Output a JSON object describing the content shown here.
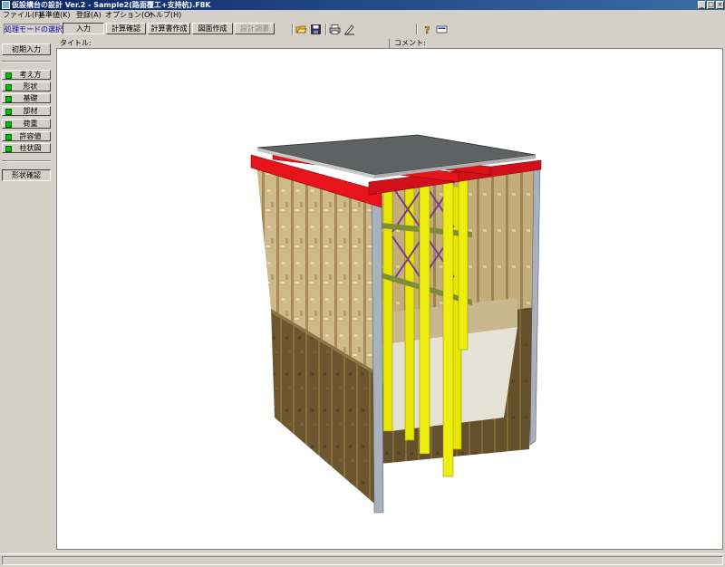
{
  "window": {
    "title": "仮設構台の設計 Ver.2 - Sample2(路面覆工+支持杭).F8K",
    "controls": {
      "minimize": "_",
      "maximize": "□",
      "close": "×"
    }
  },
  "menu": [
    "ファイル(F)",
    "基準値(K)",
    "登録(A)",
    "オプション(O)",
    "ヘルプ(H)"
  ],
  "toolbar": {
    "mode_label": "処理モードの選択",
    "buttons": [
      {
        "label": "入力",
        "selected": true,
        "enabled": true
      },
      {
        "label": "計算確認",
        "selected": false,
        "enabled": true
      },
      {
        "label": "計算書作成",
        "selected": false,
        "enabled": true
      },
      {
        "label": "図面作成",
        "selected": false,
        "enabled": true
      },
      {
        "label": "設計調書",
        "selected": false,
        "enabled": false
      }
    ],
    "icons": [
      "open-folder-icon",
      "save-icon",
      "print-icon",
      "edit-icon",
      "help-icon",
      "info-icon"
    ]
  },
  "sidebar": {
    "initial_input": "初期入力",
    "items": [
      {
        "label": "考え方",
        "status": "green"
      },
      {
        "label": "形状",
        "status": "green"
      },
      {
        "label": "基礎",
        "status": "green"
      },
      {
        "label": "部材",
        "status": "green"
      },
      {
        "label": "荷重",
        "status": "green"
      },
      {
        "label": "許容値",
        "status": "green"
      },
      {
        "label": "柱状図",
        "status": "green"
      }
    ],
    "shape_check": "形状確認"
  },
  "info": {
    "title_label": "タイトル:",
    "comment_label": "コメント:"
  },
  "colors": {
    "titlebar": "#0a246a",
    "lamp": "#00c000",
    "mode_text": "#0000c0",
    "deck": "#606060",
    "girder": "#e8141c",
    "pile": "#e6e600",
    "brace": "#7a3a8a",
    "wall_wood": "#c8b47a",
    "wall_soil": "#6a5530"
  }
}
